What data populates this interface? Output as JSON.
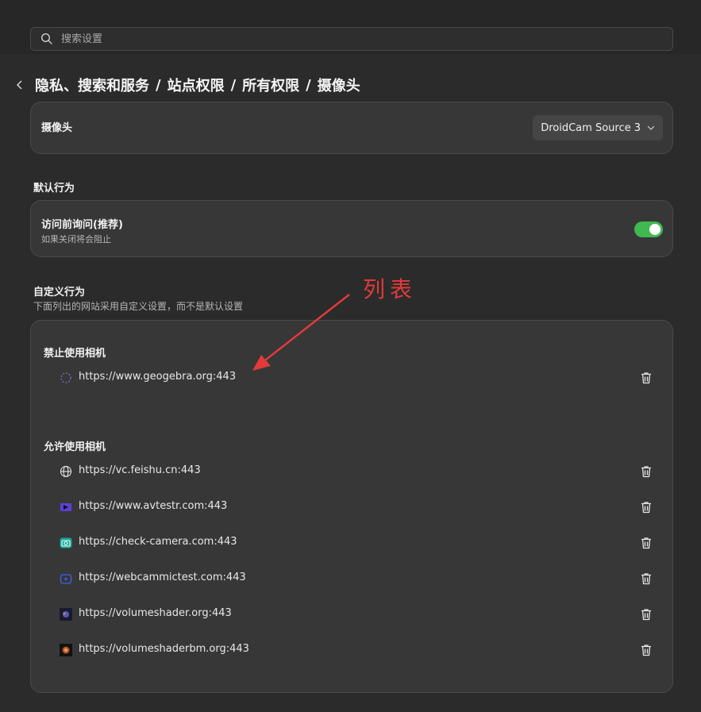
{
  "search": {
    "placeholder": "搜索设置"
  },
  "breadcrumb": {
    "items": [
      "隐私、搜索和服务",
      "站点权限",
      "所有权限",
      "摄像头"
    ],
    "separator": "/"
  },
  "camera": {
    "label": "摄像头",
    "selected_device": "DroidCam Source 3"
  },
  "default_behavior": {
    "section_title": "默认行为",
    "title": "访问前询问(推荐)",
    "subtitle": "如果关闭将会阻止",
    "toggle_on": true
  },
  "custom_behavior": {
    "section_title": "自定义行为",
    "subtitle": "下面列出的网站采用自定义设置，而不是默认设置",
    "blocked": {
      "title": "禁止使用相机",
      "sites": [
        {
          "url": "https://www.geogebra.org:443",
          "icon": "loading-spinner-icon"
        }
      ]
    },
    "allowed": {
      "title": "允许使用相机",
      "sites": [
        {
          "url": "https://vc.feishu.cn:443",
          "icon": "globe-icon"
        },
        {
          "url": "https://www.avtestr.com:443",
          "icon": "avtestr-favicon"
        },
        {
          "url": "https://check-camera.com:443",
          "icon": "camera-favicon"
        },
        {
          "url": "https://webcammictest.com:443",
          "icon": "webcam-favicon"
        },
        {
          "url": "https://volumeshader.org:443",
          "icon": "volumeshader-favicon"
        },
        {
          "url": "https://volumeshaderbm.org:443",
          "icon": "volumeshaderbm-favicon"
        }
      ]
    }
  },
  "annotation": {
    "text": "列表",
    "color": "#e03a3a"
  },
  "colors": {
    "background": "#2b2b2b",
    "card": "#373737",
    "toggle_on": "#3fb950"
  }
}
